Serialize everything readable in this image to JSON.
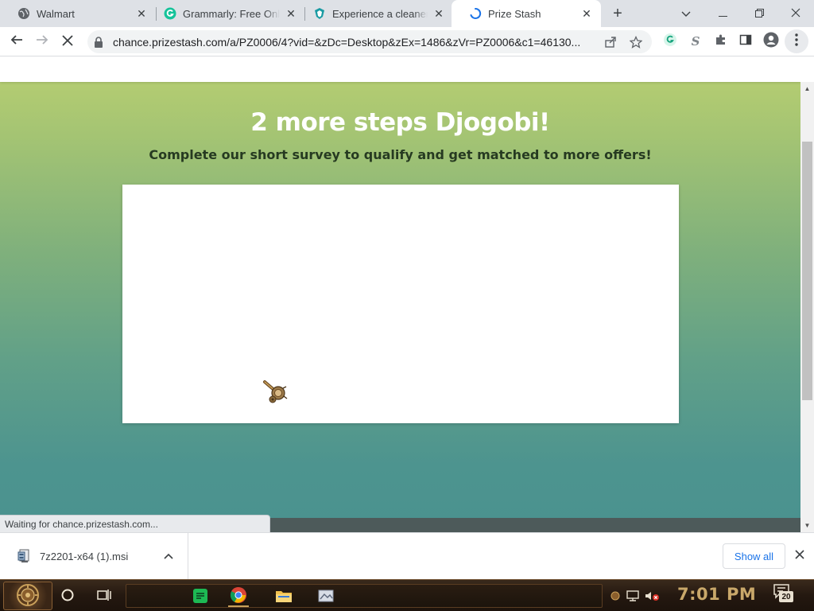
{
  "tabs": [
    {
      "title": "Walmart",
      "favicon": "globe-icon",
      "active": false
    },
    {
      "title": "Grammarly: Free Online Writing Assistant",
      "favicon": "grammarly-icon",
      "active": false
    },
    {
      "title": "Experience a cleaner internet",
      "favicon": "shield-icon",
      "active": false
    },
    {
      "title": "Prize Stash",
      "favicon": "loading-spinner-icon",
      "active": true
    }
  ],
  "toolbar": {
    "url": "chance.prizestash.com/a/PZ0006/4?vid=&zDc=Desktop&zEx=1486&zVr=PZ0006&c1=46130..."
  },
  "page": {
    "headline": "2 more steps Djogobi!",
    "subheadline": "Complete our short survey to qualify and get matched to more offers!",
    "status_text": "Waiting for chance.prizestash.com..."
  },
  "downloads": {
    "file_name": "7z2201-x64 (1).msi",
    "show_all_label": "Show all"
  },
  "taskbar": {
    "time": "7:01 PM",
    "notification_count": "20"
  },
  "colors": {
    "gradient_top": "#b3cc72",
    "gradient_bottom": "#4a928f",
    "headline": "#ffffff",
    "subheadline": "#263a21",
    "link_blue": "#1a73e8"
  }
}
